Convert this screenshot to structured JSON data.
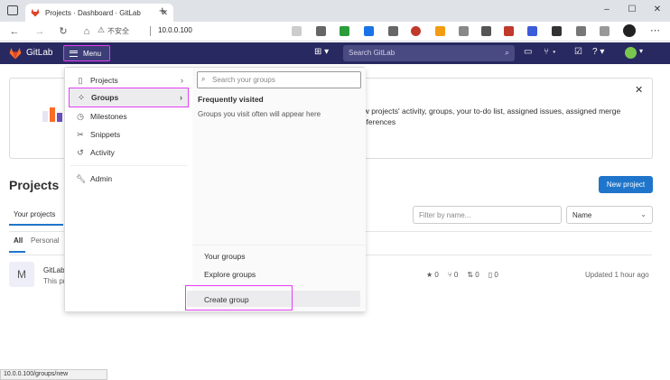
{
  "browser": {
    "tab_title": "Projects · Dashboard · GitLab",
    "insecure_label": "不安全",
    "url": "10.0.0.100",
    "status_url": "10.0.0.100/groups/new"
  },
  "header": {
    "logo_text": "GitLab",
    "menu_label": "Menu",
    "search_placeholder": "Search GitLab"
  },
  "banner": {
    "text": "ew projects' activity, groups, your to-do list, assigned issues, assigned merge references"
  },
  "page": {
    "title": "Projects",
    "new_project_label": "New project",
    "tab_your_projects": "Your projects",
    "filter_placeholder": "Filter by name...",
    "sort_value": "Name",
    "tab_all": "All",
    "tab_personal": "Personal"
  },
  "project": {
    "avatar_letter": "M",
    "name": "GitLab",
    "desc": "This pr",
    "stars": "0",
    "forks": "0",
    "mrs": "0",
    "issues": "0",
    "updated": "Updated 1 hour ago"
  },
  "menu": {
    "items": [
      {
        "label": "Projects",
        "icon": "project-icon"
      },
      {
        "label": "Groups",
        "icon": "group-icon"
      },
      {
        "label": "Milestones",
        "icon": "milestone-icon"
      },
      {
        "label": "Snippets",
        "icon": "snippet-icon"
      },
      {
        "label": "Activity",
        "icon": "history-icon"
      },
      {
        "label": "Admin",
        "icon": "wrench-icon"
      }
    ],
    "groups": {
      "search_placeholder": "Search your groups",
      "frequent_title": "Frequently visited",
      "frequent_empty": "Groups you visit often will appear here",
      "your_groups": "Your groups",
      "explore_groups": "Explore groups",
      "create_group": "Create group"
    }
  },
  "colors": {
    "header_bg": "#292961",
    "highlight": "#e43ef2",
    "primary_button": "#1f75cb"
  }
}
